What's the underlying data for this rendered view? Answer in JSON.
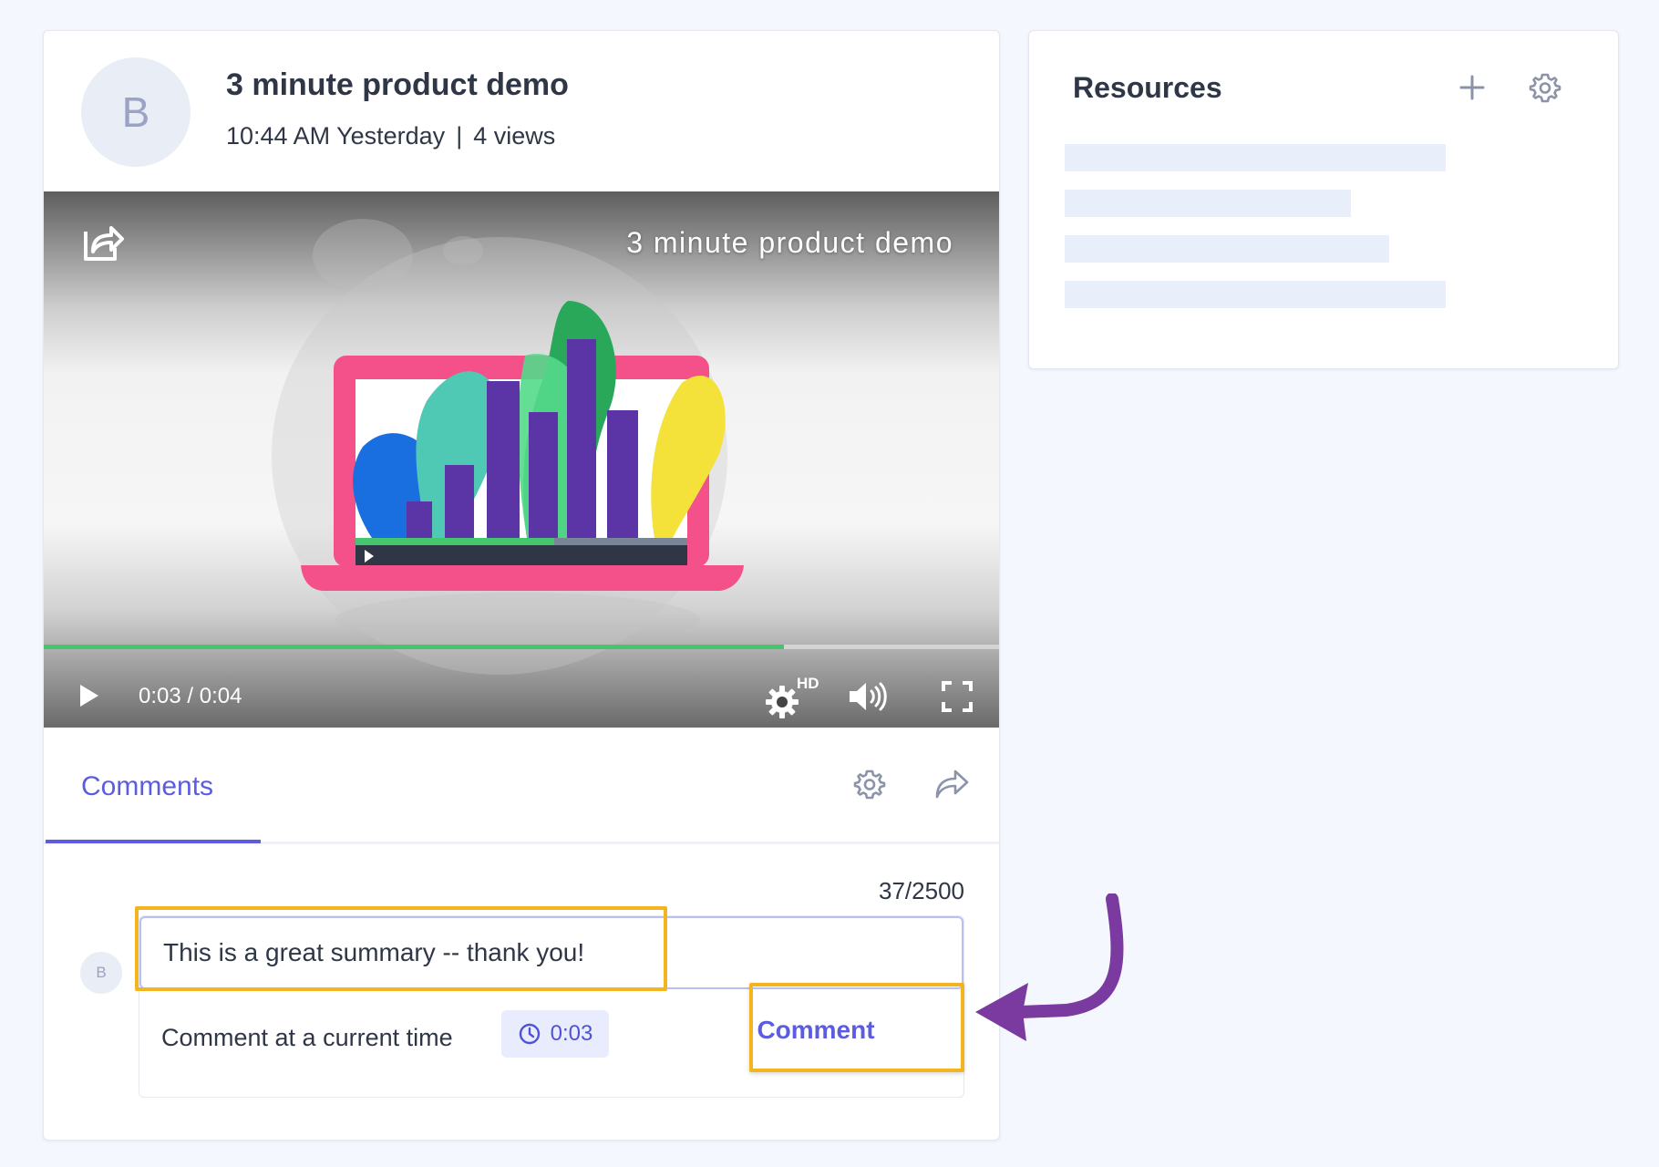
{
  "video_card": {
    "avatar_initial": "B",
    "title": "3 minute product demo",
    "meta_time": "10:44 AM Yesterday",
    "meta_separator": "|",
    "meta_views": "4 views"
  },
  "player": {
    "overlay_title": "3 minute product demo",
    "time_display": "0:03 / 0:04",
    "progress_fraction": 0.775,
    "quality_badge": "HD",
    "icons": [
      "share-icon",
      "play-icon",
      "settings-hd-icon",
      "volume-icon",
      "fullscreen-icon"
    ]
  },
  "comments": {
    "tab_label": "Comments",
    "char_counter": "37/2500",
    "avatar_initial": "B",
    "input_value": "This is a great summary -- thank you!",
    "current_time_label": "Comment at a current time",
    "time_chip": "0:03",
    "submit_label": "Comment",
    "icons": [
      "gear-icon",
      "share-icon",
      "clock-icon"
    ]
  },
  "resources": {
    "title": "Resources",
    "icons": [
      "plus-icon",
      "gear-icon"
    ]
  },
  "colors": {
    "accent": "#5b5ce2",
    "highlight": "#f2b51f",
    "arrow": "#7a3aa0",
    "progress": "#45c56e"
  }
}
